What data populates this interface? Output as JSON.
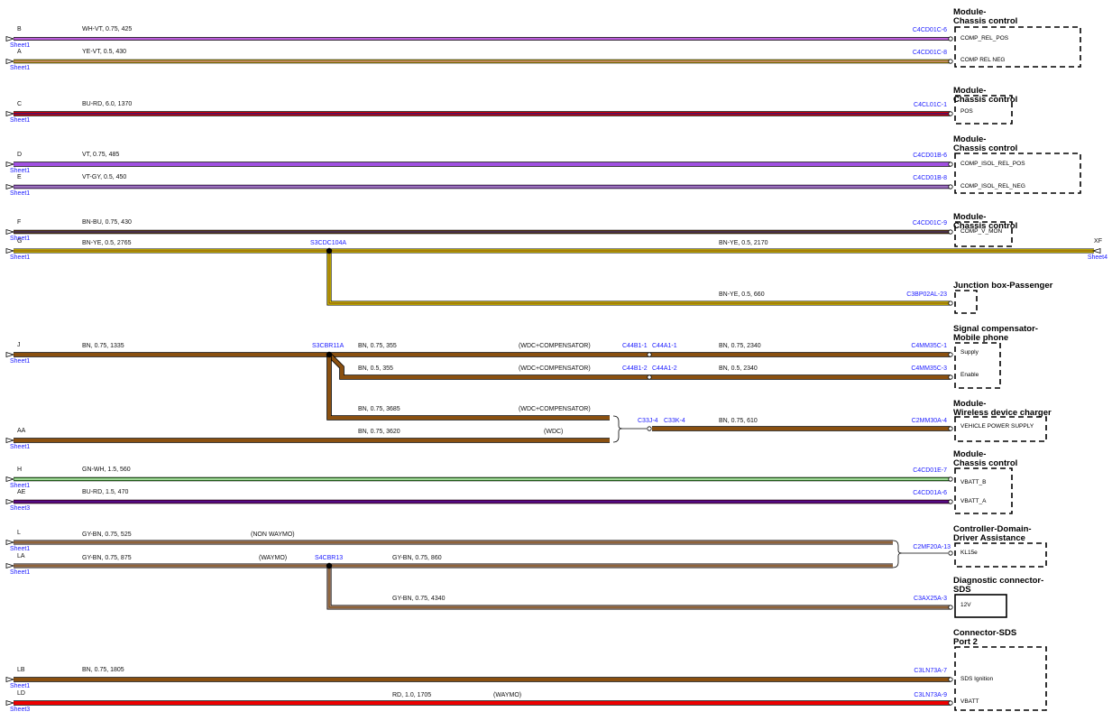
{
  "colors": {
    "WH-VT": [
      "#c060e0",
      null
    ],
    "YE-VT": [
      "#e8d000",
      "#9a40c0"
    ],
    "BU-RD": [
      "#d00000",
      "#1a1a8a"
    ],
    "VT": [
      "#a050e0",
      null
    ],
    "VT-GY": [
      "#a050e0",
      "#999999"
    ],
    "BN-BU": [
      "#7a4a10",
      "#1a1a8a"
    ],
    "BN-YE": [
      "#f0d800",
      "#7a4a10"
    ],
    "BN": [
      "#8a5010",
      null
    ],
    "GN-WH": [
      "#40b030",
      "#ffffff"
    ],
    "BU-RD-2": [
      "#8a0080",
      "#1a1a8a"
    ],
    "GY-BN": [
      "#b09080",
      "#7a4a10"
    ],
    "RD": [
      "#ee0000",
      null
    ]
  },
  "wires": [
    {
      "id": "w1",
      "pin": "B",
      "sheet": "Sheet1",
      "label": "WH-VT,  0.75,  425",
      "color": "WH-VT",
      "conn": "C4CD01C-6"
    },
    {
      "id": "w2",
      "pin": "A",
      "sheet": "Sheet1",
      "label": "YE-VT,  0.5,  430",
      "color": "YE-VT",
      "conn": "C4CD01C-8"
    },
    {
      "id": "w3",
      "pin": "C",
      "sheet": "Sheet1",
      "label": "BU-RD,  6.0,  1370",
      "color": "BU-RD",
      "conn": "C4CL01C-1"
    },
    {
      "id": "w4",
      "pin": "D",
      "sheet": "Sheet1",
      "label": "VT,  0.75,  485",
      "color": "VT",
      "conn": "C4CD01B-6"
    },
    {
      "id": "w5",
      "pin": "E",
      "sheet": "Sheet1",
      "label": "VT-GY,  0.5,  450",
      "color": "VT-GY",
      "conn": "C4CD01B-8"
    },
    {
      "id": "w6",
      "pin": "F",
      "sheet": "Sheet1",
      "label": "BN-BU,  0.75,  430",
      "color": "BN-BU",
      "conn": "C4CD01C-9"
    },
    {
      "id": "w7",
      "pin": "G",
      "sheet": "Sheet1",
      "label": "BN-YE,  0.5,  2765",
      "label2": "BN-YE,  0.5,  2170",
      "color": "BN-YE",
      "splice": "S3CDC104A",
      "right_pin": "XF",
      "right_sheet": "Sheet4"
    },
    {
      "id": "w7b",
      "label": "BN-YE,  0.5,  660",
      "conn": "C3BP02AL-23"
    },
    {
      "id": "w8",
      "pin": "J",
      "sheet": "Sheet1",
      "label": "BN,  0.75,  1335",
      "splice": "S3CBR11A"
    },
    {
      "id": "w8a",
      "label": "BN,  0.75,  355",
      "note": "(WDC+COMPENSATOR)",
      "inline1": "C44B1-1",
      "inline2": "C44A1-1",
      "label2": "BN,  0.75,  2340",
      "conn": "C4MM35C-1"
    },
    {
      "id": "w8b",
      "label": "BN,  0.5,  355",
      "note": "(WDC+COMPENSATOR)",
      "inline1": "C44B1-2",
      "inline2": "C44A1-2",
      "label2": "BN,  0.5,  2340",
      "conn": "C4MM35C-3"
    },
    {
      "id": "w8c",
      "label": "BN,  0.75,  3685",
      "note": "(WDC+COMPENSATOR)"
    },
    {
      "id": "w9",
      "pin": "AA",
      "sheet": "Sheet1",
      "label": "BN,  0.75,  3620",
      "note": "(WDC)",
      "inline1": "C33J-4",
      "inline2": "C33K-4",
      "label2": "BN,  0.75,  610",
      "conn": "C2MM30A-4"
    },
    {
      "id": "w10",
      "pin": "H",
      "sheet": "Sheet1",
      "label": "GN-WH,  1.5,  560",
      "color": "GN-WH",
      "conn": "C4CD01E-7"
    },
    {
      "id": "w11",
      "pin": "AE",
      "sheet": "Sheet3",
      "label": "BU-RD,  1.5,  470",
      "color": "BU-RD-2",
      "conn": "C4CD01A-6"
    },
    {
      "id": "w12",
      "pin": "L",
      "sheet": "Sheet1",
      "label": "GY-BN,  0.75,  525",
      "note": "(NON WAYMO)"
    },
    {
      "id": "w13",
      "pin": "LA",
      "sheet": "Sheet1",
      "label": "GY-BN,  0.75,  875",
      "note": "(WAYMO)",
      "splice": "S4CBR13",
      "label2": "GY-BN,  0.75,  860",
      "conn": "C2MF20A-13"
    },
    {
      "id": "w13b",
      "label": "GY-BN,  0.75,  4340",
      "conn": "C3AX25A-3"
    },
    {
      "id": "w14",
      "pin": "LB",
      "sheet": "Sheet1",
      "label": "BN,  0.75,  1805",
      "conn": "C3LN73A-7"
    },
    {
      "id": "w15",
      "pin": "LD",
      "sheet": "Sheet3",
      "label": "RD,  1.0,  1705",
      "note": "(WAYMO)",
      "conn": "C3LN73A-9"
    }
  ],
  "components": [
    {
      "id": "c1",
      "title1": "Module-",
      "title2": "Chassis control",
      "pins": [
        "COMP_REL_POS",
        "COMP REL NEG"
      ]
    },
    {
      "id": "c2",
      "title1": "Module-",
      "title2": "Chassis control",
      "pins": [
        "POS"
      ]
    },
    {
      "id": "c3",
      "title1": "Module-",
      "title2": "Chassis control",
      "pins": [
        "COMP_ISOL_REL_POS",
        "COMP_ISOL_REL_NEG"
      ]
    },
    {
      "id": "c4",
      "title1": "Module-",
      "title2": "Chassis control",
      "pins": [
        "COMP_V_MON"
      ]
    },
    {
      "id": "c5",
      "title1": "Junction box-Passenger",
      "title2": "",
      "pins": []
    },
    {
      "id": "c6",
      "title1": "Signal compensator-",
      "title2": "Mobile phone",
      "pins": [
        "Supply",
        "Enable"
      ]
    },
    {
      "id": "c7",
      "title1": "Module-",
      "title2": "Wireless device charger",
      "pins": [
        "VEHICLE POWER SUPPLY"
      ]
    },
    {
      "id": "c8",
      "title1": "Module-",
      "title2": "Chassis control",
      "pins": [
        "VBATT_B",
        "VBATT_A"
      ]
    },
    {
      "id": "c9",
      "title1": "Controller-Domain-",
      "title2": "Driver Assistance",
      "pins": [
        "KL15e"
      ]
    },
    {
      "id": "c10",
      "title1": "Diagnostic connector-",
      "title2": "SDS",
      "pins": [
        "12V"
      ]
    },
    {
      "id": "c11",
      "title1": "Connector-SDS",
      "title2": "Port 2",
      "pins": [
        "SDS Ignition",
        "VBATT"
      ]
    }
  ]
}
